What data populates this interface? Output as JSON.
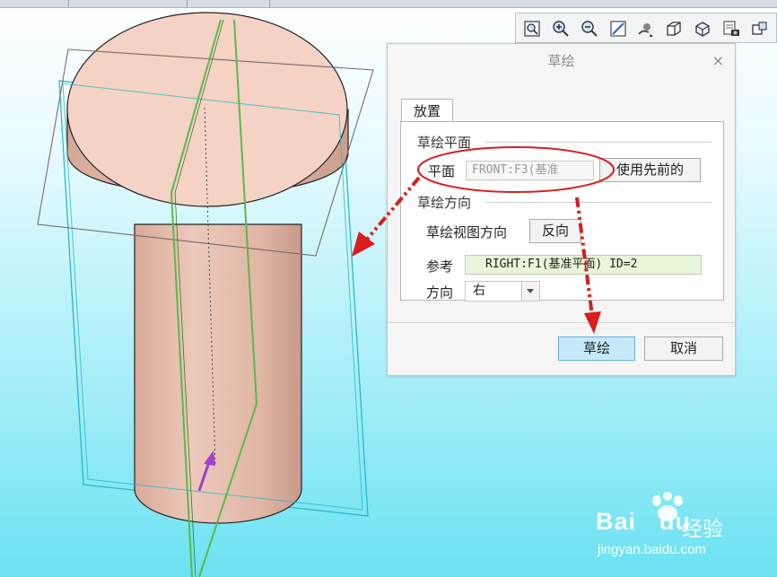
{
  "dialog": {
    "title": "草绘",
    "close_glyph": "×",
    "tab_label": "放置",
    "section_plane": {
      "header": "草绘平面",
      "plane_label": "平面",
      "plane_value": "FRONT:F3(基准",
      "use_previous_label": "使用先前的"
    },
    "section_orient": {
      "header": "草绘方向",
      "view_dir_label": "草绘视图方向",
      "flip_label": "反向",
      "ref_label": "参考",
      "ref_value": "RIGHT:F1(基准平面) ID=2",
      "dir_label": "方向",
      "dir_value": "右"
    },
    "ok_label": "草绘",
    "cancel_label": "取消"
  },
  "toolbar": {
    "icons": [
      "zoom-fit-icon",
      "zoom-in-icon",
      "zoom-out-icon",
      "repaint-icon",
      "spin-center-icon",
      "view-orientation-icon",
      "saved-views-icon",
      "view-manager-icon",
      "display-style-icon"
    ]
  },
  "watermark": {
    "brand": "Bai",
    "brand_suffix": "du",
    "cn": "经验",
    "url": "jingyan.baidu.com"
  },
  "colors": {
    "model": "#e8c2b4",
    "datum_plane_cyan": "#2ab7c8",
    "datum_plane_gray": "#7a6a6a",
    "curve_green": "#5cb84a",
    "arrow_red": "#d81e1e",
    "arrow_purple": "#a040d0",
    "highlight_blue": "#c6e9fa",
    "ref_field_green": "#e7f6d6"
  }
}
